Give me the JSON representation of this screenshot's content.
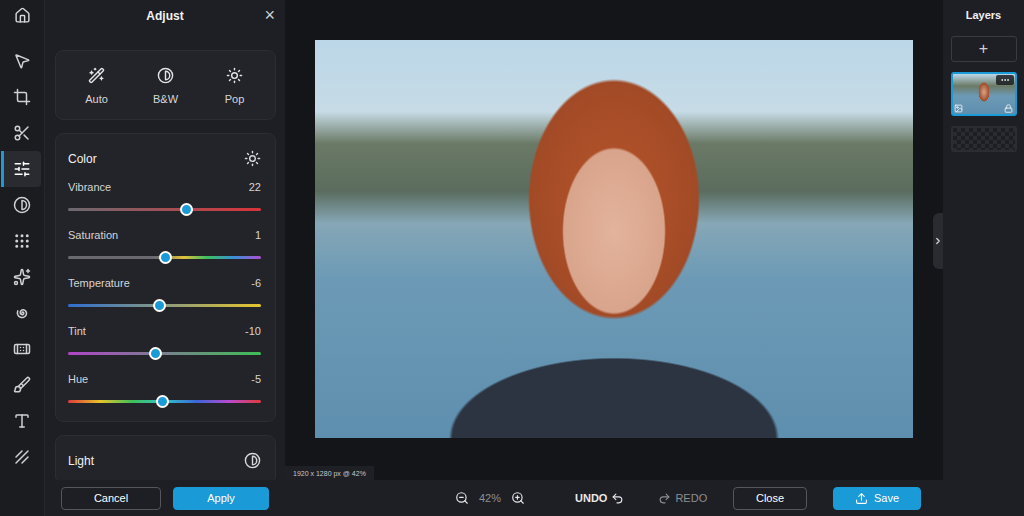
{
  "tools": [
    {
      "selected": false
    },
    {
      "selected": false
    },
    {
      "selected": false
    },
    {
      "selected": false
    },
    {
      "selected": true
    },
    {
      "selected": false
    },
    {
      "selected": false
    },
    {
      "selected": false
    },
    {
      "selected": false
    },
    {
      "selected": false
    },
    {
      "selected": false
    },
    {
      "selected": false
    },
    {
      "selected": false
    }
  ],
  "panel": {
    "title": "Adjust",
    "close": "×"
  },
  "presets": [
    {
      "label": "Auto"
    },
    {
      "label": "B&W"
    },
    {
      "label": "Pop"
    }
  ],
  "color": {
    "title": "Color",
    "sliders": [
      {
        "label": "Vibrance",
        "value": "22",
        "level": 0.61,
        "kind": "vibrance"
      },
      {
        "label": "Saturation",
        "value": "1",
        "level": 0.505,
        "kind": "saturation"
      },
      {
        "label": "Temperature",
        "value": "-6",
        "level": 0.47,
        "kind": "temperature"
      },
      {
        "label": "Tint",
        "value": "-10",
        "level": 0.45,
        "kind": "tint"
      },
      {
        "label": "Hue",
        "value": "-5",
        "level": 0.485,
        "kind": "hue"
      }
    ]
  },
  "light": {
    "title": "Light"
  },
  "actions": {
    "cancel": "Cancel",
    "apply": "Apply"
  },
  "canvas": {
    "info": "1920 x 1280 px @ 42%"
  },
  "toolbar": {
    "zoom": "42%",
    "undo": "UNDO",
    "redo": "REDO",
    "close": "Close",
    "save": "Save"
  },
  "layers": {
    "title": "Layers",
    "add": "+",
    "items": [
      {
        "kind": "photo",
        "selected": true,
        "locked": true
      },
      {
        "kind": "empty",
        "selected": false,
        "locked": false
      }
    ]
  }
}
